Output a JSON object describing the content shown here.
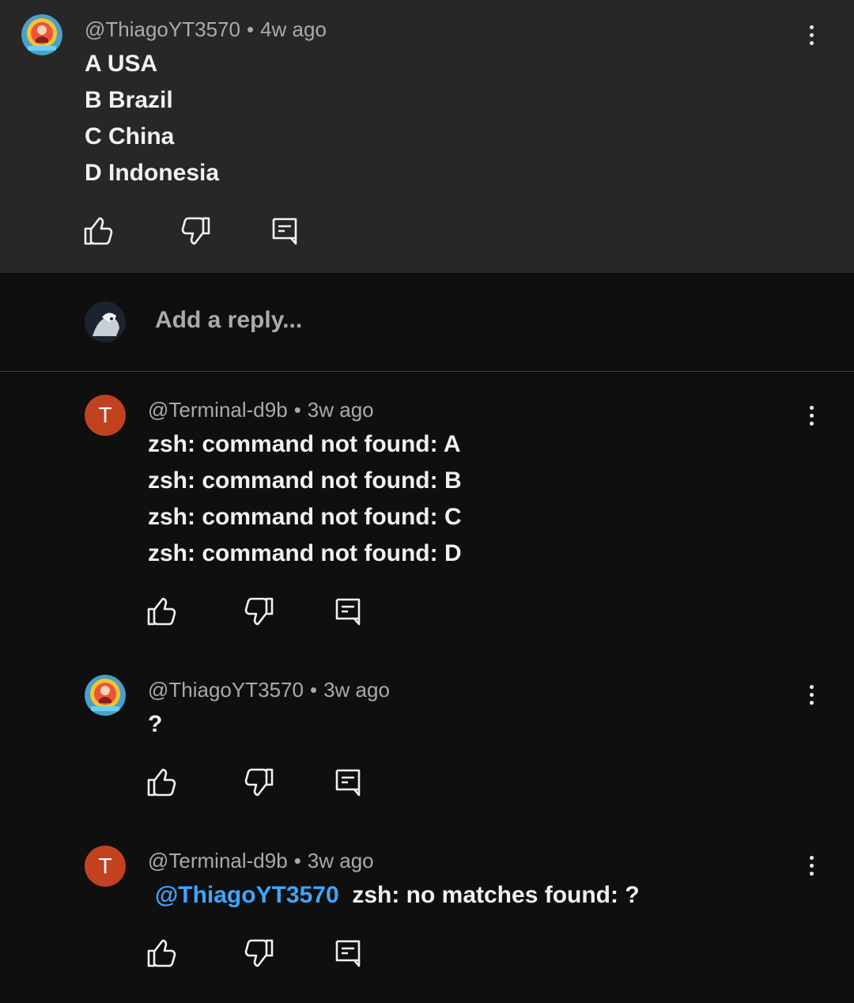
{
  "top_comment": {
    "author": "@ThiagoYT3570",
    "time": "4w ago",
    "lines": [
      "A USA",
      "B Brazil",
      "C China",
      "D Indonesia"
    ]
  },
  "reply_box": {
    "placeholder": "Add a reply..."
  },
  "replies": [
    {
      "avatar_letter": "T",
      "author": "@Terminal-d9b",
      "time": "3w ago",
      "lines": [
        "zsh: command not found: A",
        "zsh: command not found: B",
        "zsh: command not found: C",
        "zsh: command not found: D"
      ]
    },
    {
      "author": "@ThiagoYT3570",
      "time": "3w ago",
      "lines": [
        "?"
      ]
    },
    {
      "avatar_letter": "T",
      "author": "@Terminal-d9b",
      "time": "3w ago",
      "mention": "@ThiagoYT3570",
      "text": "zsh: no matches found: ?"
    }
  ],
  "separator": "•",
  "colors": {
    "accent_avatar": "#c2421f",
    "mention": "#3ea6ff",
    "card_bg": "#272727",
    "page_bg": "#0f0f0f"
  },
  "icons": [
    "thumbs-up-icon",
    "thumbs-down-icon",
    "reply-icon",
    "more-vert-icon"
  ]
}
